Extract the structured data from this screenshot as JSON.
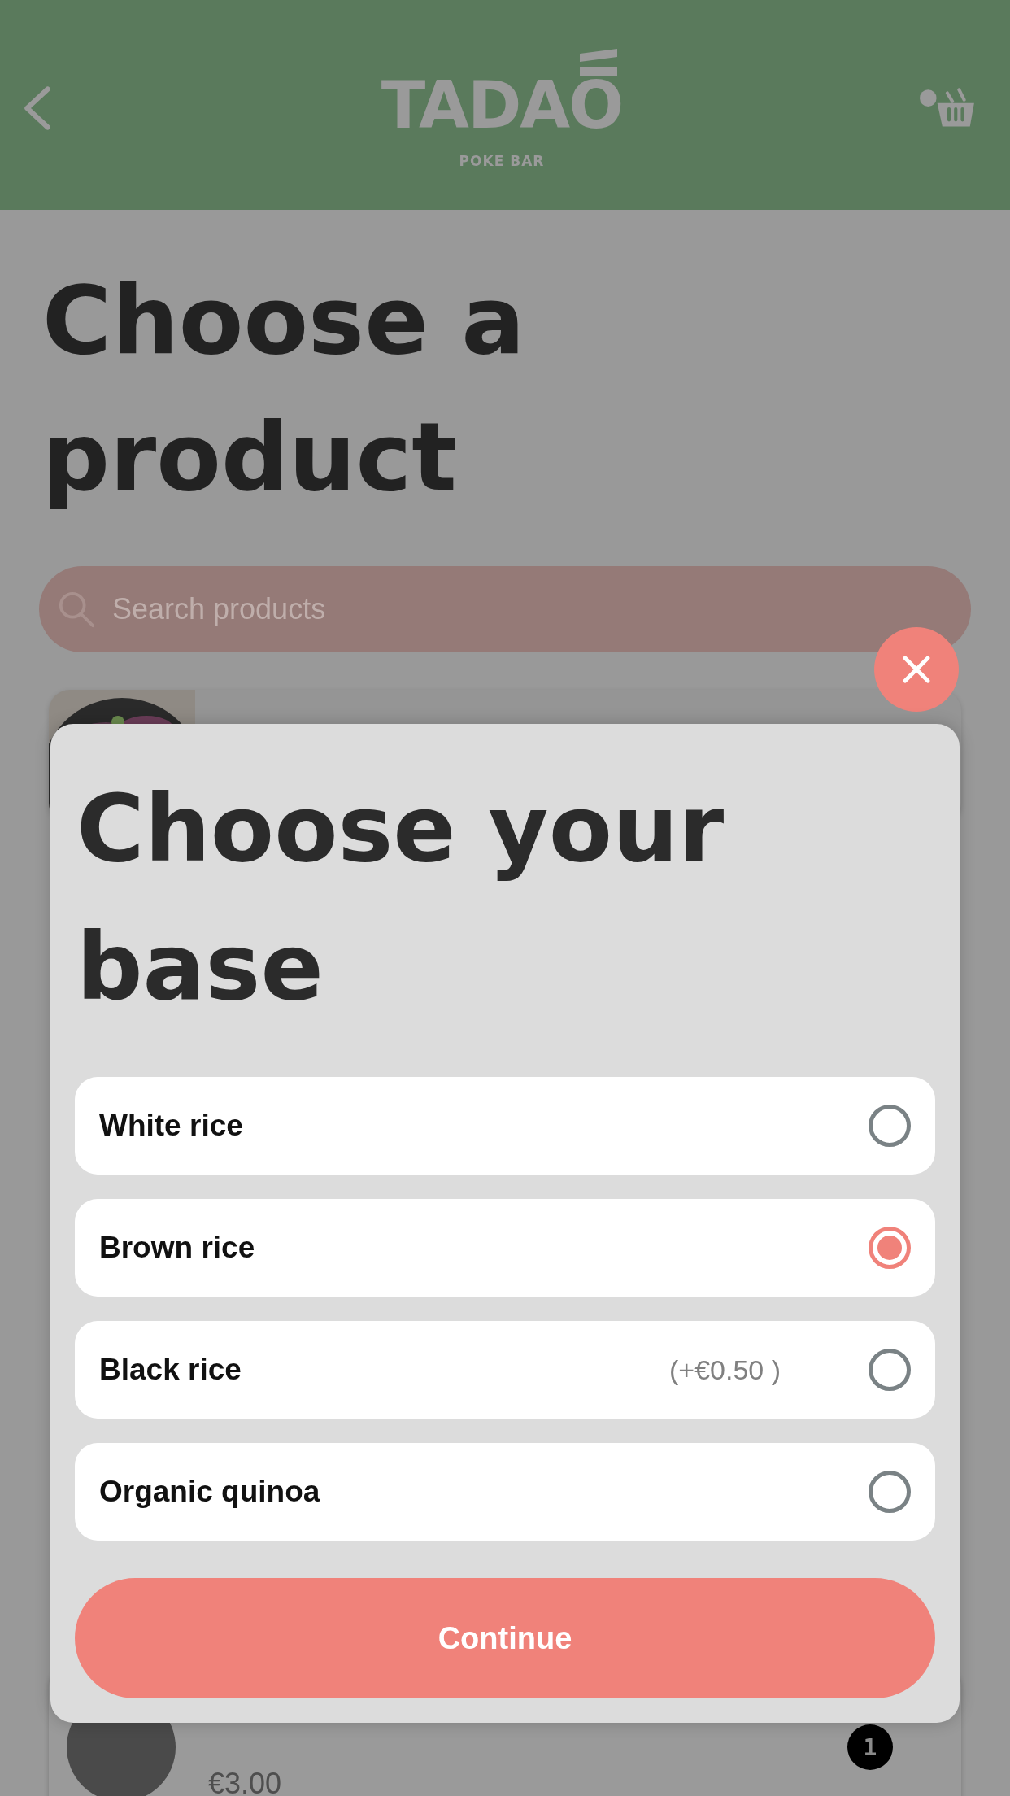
{
  "header": {
    "logo": "TADAO",
    "logo_subtitle": "POKE BAR"
  },
  "page": {
    "title": "Choose a product",
    "search": {
      "placeholder": "Search products"
    },
    "bottom_card": {
      "price": "€3.00",
      "badge": "1"
    }
  },
  "modal": {
    "title": "Choose your base",
    "options": [
      {
        "label": "White rice",
        "selected": false
      },
      {
        "label": "Brown rice",
        "selected": true
      },
      {
        "label": "Black rice",
        "price": "(+€0.50 )",
        "selected": false
      },
      {
        "label": "Organic quinoa",
        "selected": false
      }
    ],
    "button": "Continue"
  }
}
